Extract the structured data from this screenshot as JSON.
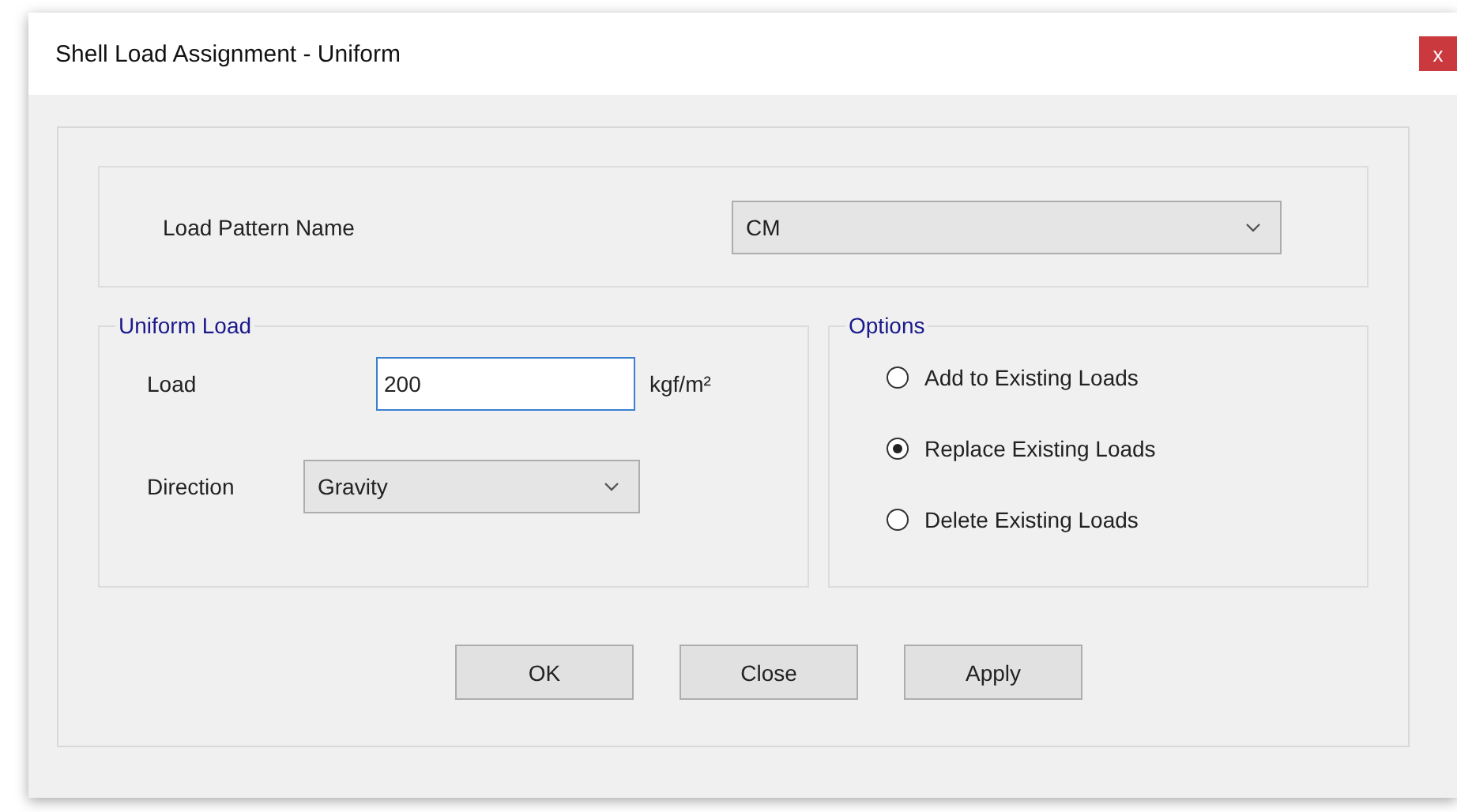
{
  "window": {
    "title": "Shell Load Assignment - Uniform",
    "close_label": "x"
  },
  "load_pattern": {
    "label": "Load Pattern Name",
    "value": "CM"
  },
  "uniform_load": {
    "title": "Uniform Load",
    "load": {
      "label": "Load",
      "value": "200",
      "unit": "kgf/m²",
      "focused": true
    },
    "direction": {
      "label": "Direction",
      "value": "Gravity"
    }
  },
  "options": {
    "title": "Options",
    "items": [
      {
        "label": "Add to Existing Loads",
        "selected": false
      },
      {
        "label": "Replace Existing Loads",
        "selected": true
      },
      {
        "label": "Delete Existing Loads",
        "selected": false
      }
    ]
  },
  "buttons": [
    "OK",
    "Close",
    "Apply"
  ]
}
